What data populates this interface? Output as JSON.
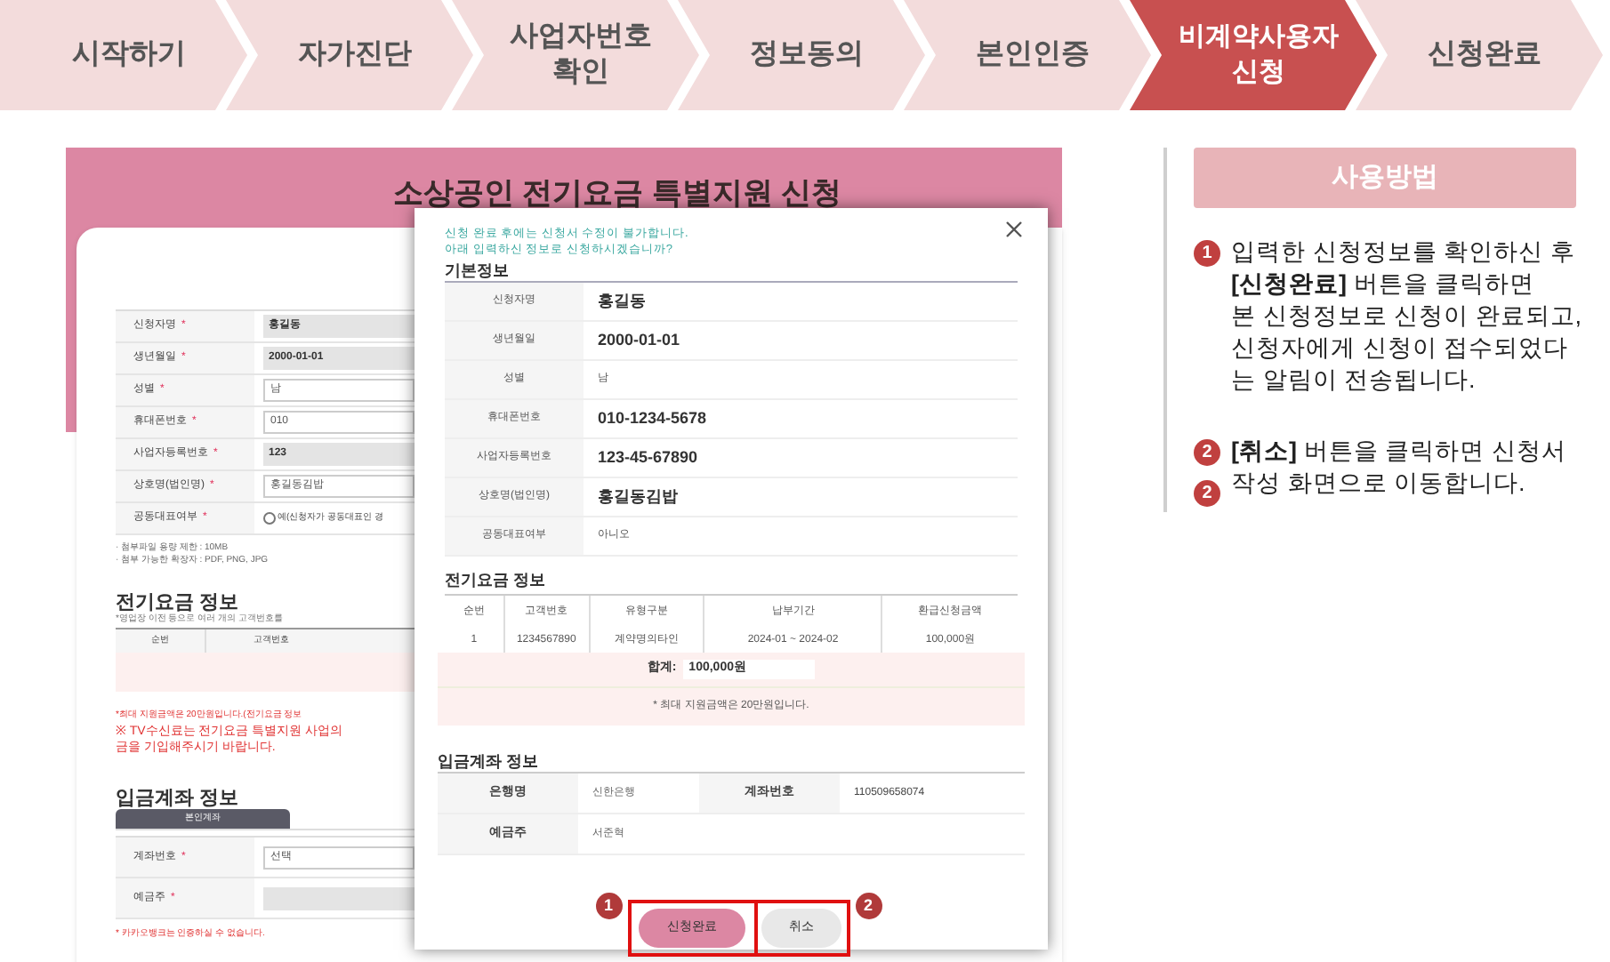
{
  "steps": [
    {
      "lines": [
        "시작하기"
      ],
      "selected": false
    },
    {
      "lines": [
        "자가진단"
      ],
      "selected": false
    },
    {
      "lines": [
        "사업자번호",
        "확인"
      ],
      "selected": false
    },
    {
      "lines": [
        "정보동의"
      ],
      "selected": false
    },
    {
      "lines": [
        "본인인증"
      ],
      "selected": false
    },
    {
      "lines": [
        "비계약사용자",
        "신청"
      ],
      "selected": true
    },
    {
      "lines": [
        "신청완료"
      ],
      "selected": false
    }
  ],
  "form": {
    "title": "소상공인 전기요금 특별지원 신청",
    "fields": [
      {
        "label": "신청자명",
        "mark": "*",
        "kind": "readonly",
        "value": "홍길동"
      },
      {
        "label": "생년월일",
        "mark": "*",
        "kind": "readonly",
        "value": "2000-01-01"
      },
      {
        "label": "성별",
        "mark": "*",
        "kind": "input",
        "value": "남"
      },
      {
        "label": "휴대폰번호",
        "mark": "*",
        "kind": "input",
        "value": "010"
      },
      {
        "label": "사업자등록번호",
        "mark": "*",
        "kind": "readonly",
        "value": "123"
      },
      {
        "label": "상호명(법인명)",
        "mark": "*",
        "kind": "input",
        "value": "홍길동김밥"
      },
      {
        "label": "공동대표여부",
        "mark": "*",
        "kind": "radio",
        "value": "예(신청자가 공동대표인 경",
        "checked": false
      }
    ],
    "notes": [
      "· 첨부파일 용량 제한 : 10MB",
      "· 첨부 가능한 확장자 : PDF, PNG, JPG"
    ],
    "bill": {
      "title": "전기요금 정보",
      "note": "*영업장 이전 등으로 여러 개의 고객번호를",
      "columns": [
        "순번",
        "고객번호"
      ]
    },
    "warnings": [
      "*최대 지원금액은 20만원입니다.(전기요금 정보",
      "※ TV수신료는 전기요금 특별지원 사업의",
      "금을 기입해주시기 바랍니다."
    ],
    "account": {
      "title": "입금계좌 정보",
      "tab": "본인계좌",
      "fields": [
        {
          "label": "계좌번호",
          "mark": "*",
          "kind": "select",
          "value": "선택"
        },
        {
          "label": "예금주",
          "mark": "*",
          "kind": "readonly"
        }
      ],
      "note": "* 카카오뱅크는 인증하실 수 없습니다."
    }
  },
  "dialog": {
    "notice": [
      "신청 완료 후에는 신청서 수정이 불가합니다.",
      "아래 입력하신 정보로 신청하시겠습니까?"
    ],
    "basic": {
      "title": "기본정보",
      "rows": [
        {
          "label": "신청자명",
          "value": "홍길동",
          "emphasis": true
        },
        {
          "label": "생년월일",
          "value": "2000-01-01",
          "emphasis": true
        },
        {
          "label": "성별",
          "value": "남",
          "emphasis": false
        },
        {
          "label": "휴대폰번호",
          "value": "010-1234-5678",
          "emphasis": true
        },
        {
          "label": "사업자등록번호",
          "value": "123-45-67890",
          "emphasis": true
        },
        {
          "label": "상호명(법인명)",
          "value": "홍길동김밥",
          "emphasis": true
        },
        {
          "label": "공동대표여부",
          "value": "아니오",
          "emphasis": false
        }
      ]
    },
    "bill": {
      "title": "전기요금 정보",
      "columns": [
        "순번",
        "고객번호",
        "유형구분",
        "납부기간",
        "환급신청금액"
      ],
      "rows": [
        [
          "1",
          "1234567890",
          "계약명의타인",
          "2024-01 ~ 2024-02",
          "100,000원"
        ]
      ],
      "total_label": "합계:",
      "total": "100,000원",
      "note": "* 최대 지원금액은 20만원입니다."
    },
    "account": {
      "title": "입금계좌 정보",
      "bank_label": "은행명",
      "bank": "신한은행",
      "number_label": "계좌번호",
      "number": "110509658074",
      "holder_label": "예금주",
      "holder": "서준혁"
    },
    "buttons": [
      {
        "label": "신청완료",
        "kind": "primary",
        "marker": "1"
      },
      {
        "label": "취소",
        "kind": "secondary",
        "marker": "2"
      }
    ]
  },
  "guide": {
    "title": "사용방법",
    "items": [
      {
        "markers": [
          "1"
        ],
        "text": "입력한 신청정보를 확인하신 후\n**[신청완료]** 버튼을 클릭하면\n본 신청정보로 신청이 완료되고,\n신청자에게 신청이 접수되었다\n는 알림이 전송됩니다."
      },
      {
        "markers": [
          "2",
          "2"
        ],
        "text": "**[취소]** 버튼을 클릭하면 신청서\n작성 화면으로 이동합니다."
      }
    ]
  }
}
